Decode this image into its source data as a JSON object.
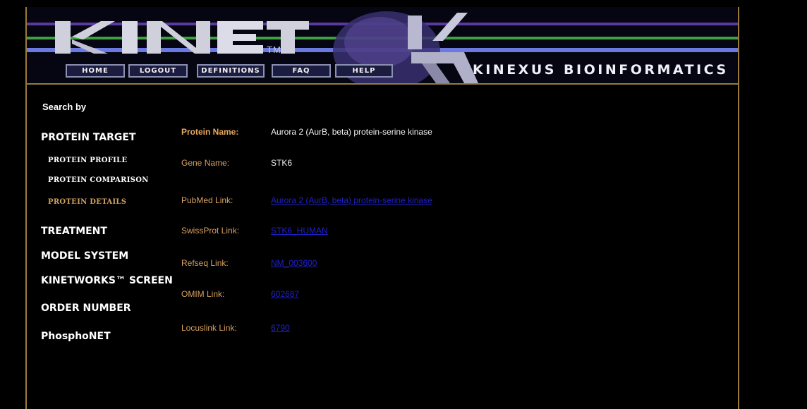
{
  "header": {
    "logo_text": "KINET",
    "trademark": "TM",
    "brand": "KINEXUS BIOINFORMATICS",
    "nav": [
      {
        "label": "HOME"
      },
      {
        "label": "LOGOUT"
      },
      {
        "label": "DEFINITIONS"
      },
      {
        "label": "FAQ"
      },
      {
        "label": "HELP"
      }
    ],
    "colors": {
      "purple": "#5a3aa0",
      "green": "#3ea03e",
      "blue": "#6a7ae0",
      "border": "#9a7a3a"
    }
  },
  "sidebar": {
    "title": "Search by",
    "protein_target": "PROTEIN TARGET",
    "sub_items": [
      {
        "label": "PROTEIN PROFILE",
        "active": false
      },
      {
        "label": "PROTEIN COMPARISON",
        "active": false
      },
      {
        "label": "PROTEIN DETAILS",
        "active": true
      }
    ],
    "items": [
      {
        "label": "TREATMENT"
      },
      {
        "label": "MODEL SYSTEM"
      },
      {
        "label": "KINETWORKS™ SCREEN"
      },
      {
        "label": "ORDER NUMBER"
      },
      {
        "label": "PhosphoNET"
      }
    ]
  },
  "details": {
    "protein_name": {
      "label": "Protein Name:",
      "value": "Aurora 2 (AurB, beta) protein-serine kinase"
    },
    "gene_name": {
      "label": "Gene Name:",
      "value": "STK6"
    },
    "pubmed": {
      "label": "PubMed Link:",
      "value": "Aurora 2 (AurB, beta) protein-serine kinase"
    },
    "swissprot": {
      "label": "SwissProt Link:",
      "value": "STK6_HUMAN"
    },
    "refseq": {
      "label": "Refseq Link:",
      "value": "NM_003600"
    },
    "omim": {
      "label": "OMIM Link:",
      "value": "602687"
    },
    "locuslink": {
      "label": "Locuslink Link:",
      "value": "6790"
    }
  }
}
